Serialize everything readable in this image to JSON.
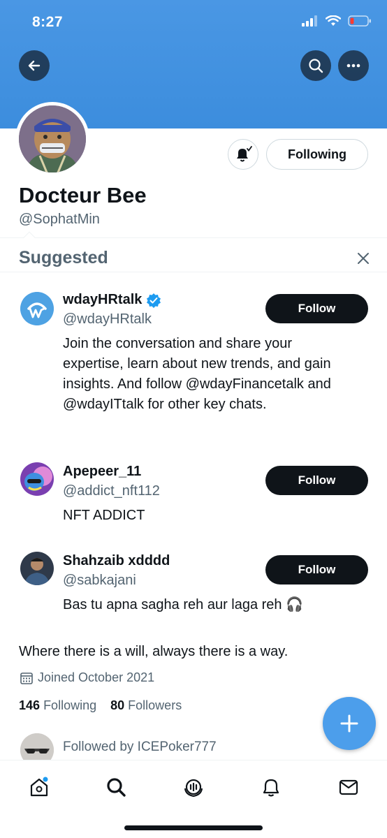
{
  "status_bar": {
    "time": "8:27"
  },
  "profile": {
    "display_name": "Docteur Bee",
    "handle": "@SophatMin",
    "following_button": "Following",
    "bio": "Where there is a will, always there is a way.",
    "joined": "Joined October 2021",
    "following_count": "146",
    "following_label": "Following",
    "followers_count": "80",
    "followers_label": "Followers",
    "followed_by": "Followed by ICEPoker777"
  },
  "suggested": {
    "title": "Suggested",
    "items": [
      {
        "name": "wdayHRtalk",
        "verified": true,
        "handle": "@wdayHRtalk",
        "bio": "Join the conversation and share your expertise, learn about new trends, and gain insights. And follow @wdayFinancetalk and @wdayITtalk for other key chats.",
        "button": "Follow"
      },
      {
        "name": "Apepeer_11",
        "verified": false,
        "handle": "@addict_nft112",
        "bio": "NFT ADDICT",
        "button": "Follow"
      },
      {
        "name": "Shahzaib xdddd",
        "verified": false,
        "handle": "@sabkajani",
        "bio": "Bas tu apna sagha reh aur laga reh 🎧",
        "button": "Follow"
      }
    ]
  },
  "colors": {
    "banner": "#3c8ddd",
    "accent": "#1d9bf0",
    "fab": "#4c9eeb",
    "follow_button": "#0f1419",
    "secondary_text": "#536471"
  },
  "tabs": [
    "home-icon",
    "search-icon",
    "spaces-icon",
    "notifications-icon",
    "messages-icon"
  ]
}
